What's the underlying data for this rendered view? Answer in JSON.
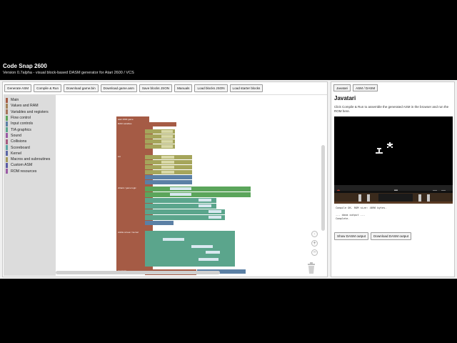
{
  "header": {
    "title": "Code Snap 2600",
    "subtitle": "Version 0.7alpha - visual block-based DASM generator for Atari 2600 / VCS"
  },
  "toolbar": [
    "Generate ASM",
    "Compile & Run",
    "Download game.bin",
    "Download game.asm",
    "Save blocks JSON",
    "Manuals",
    "Load blocks JSON",
    "Load starter blocks"
  ],
  "categories": [
    {
      "label": "Main",
      "color": "#a55b45"
    },
    {
      "label": "Values and RAM",
      "color": "#a5845b"
    },
    {
      "label": "Variables and registers",
      "color": "#a5745b"
    },
    {
      "label": "Flow control",
      "color": "#5ba55b"
    },
    {
      "label": "Input controls",
      "color": "#5b80a5"
    },
    {
      "label": "TIA graphics",
      "color": "#5ba58c"
    },
    {
      "label": "Sound",
      "color": "#995ba5"
    },
    {
      "label": "Collisions",
      "color": "#a55b80"
    },
    {
      "label": "Scoreboard",
      "color": "#5ba5a5"
    },
    {
      "label": "Kernel",
      "color": "#5b67a5"
    },
    {
      "label": "Macros and subroutines",
      "color": "#a59a5b"
    },
    {
      "label": "Custom ASM",
      "color": "#5b5ba5"
    },
    {
      "label": "ROM resources",
      "color": "#9a5ba5"
    }
  ],
  "blocks": {
    "main_title": "atari 2600 game",
    "rom_vars": "RAM variables",
    "init": "init",
    "vblank": "vblank / game logic",
    "kernel": "visible screen / kernel",
    "overscan": "overscan",
    "rom": "ROM resources"
  },
  "right_panel": {
    "tabs": [
      "Javatari",
      "ASM / DASM"
    ],
    "heading": "Javatari",
    "description": "Click Compile & Run to assemble the generated ASM in the browser and run the ROM here.",
    "log_lines": [
      "Compile OK. ROM size: 4096 bytes.",
      "",
      "--- dasm output ---",
      "Complete."
    ],
    "buttons": [
      "Show DASM output",
      "Download DASM output"
    ]
  },
  "colors": {
    "main_block": "#a55b45",
    "var_block": "#a5a55b",
    "flow_block": "#5ba55b",
    "tia_block": "#5ba58c",
    "input_block": "#5b80a5",
    "rom_block": "#995ba5"
  },
  "icons": {
    "trash": "trash-icon",
    "zoom_in": "zoom-in-icon",
    "zoom_out": "zoom-out-icon",
    "zoom_reset": "zoom-reset-icon"
  }
}
